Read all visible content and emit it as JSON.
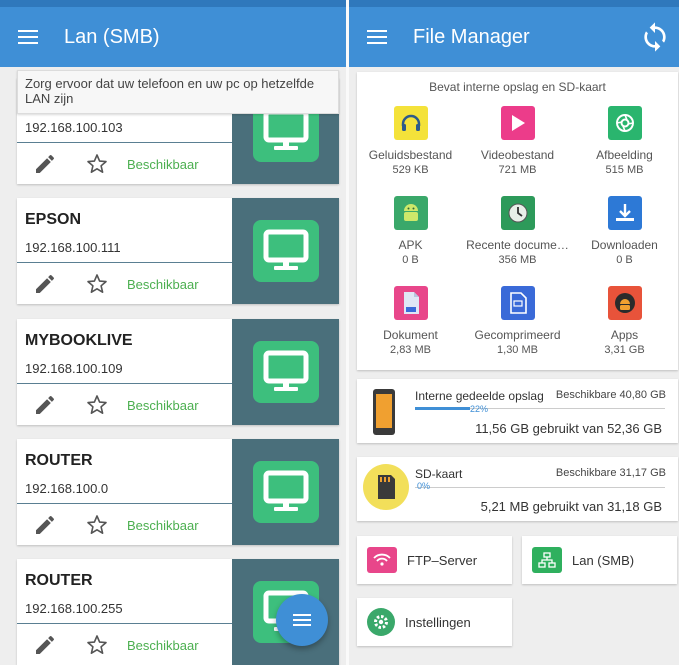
{
  "left": {
    "title": "Lan (SMB)",
    "hint": "Zorg ervoor dat uw telefoon en uw pc op hetzelfde LAN zijn",
    "devices": [
      {
        "name": "",
        "ip": "192.168.100.103",
        "status": "Beschikbaar"
      },
      {
        "name": "EPSON",
        "ip": "192.168.100.111",
        "status": "Beschikbaar"
      },
      {
        "name": "MYBOOKLIVE",
        "ip": "192.168.100.109",
        "status": "Beschikbaar"
      },
      {
        "name": "ROUTER",
        "ip": "192.168.100.0",
        "status": "Beschikbaar"
      },
      {
        "name": "ROUTER",
        "ip": "192.168.100.255",
        "status": "Beschikbaar"
      }
    ]
  },
  "right": {
    "title": "File Manager",
    "categories_header": "Bevat interne opslag en SD-kaart",
    "categories": [
      {
        "label": "Geluidsbestand",
        "size": "529 KB",
        "icon": "headphones-icon",
        "color": "#f4e23a"
      },
      {
        "label": "Videobestand",
        "size": "721 MB",
        "icon": "play-icon",
        "color": "#ec3c8a"
      },
      {
        "label": "Afbeelding",
        "size": "515 MB",
        "icon": "camera-aperture-icon",
        "color": "#2ab56e"
      },
      {
        "label": "APK",
        "size": "0 B",
        "icon": "android-icon",
        "color": "#3aa86a"
      },
      {
        "label": "Recente docume…",
        "size": "356 MB",
        "icon": "clock-icon",
        "color": "#2d9a5a"
      },
      {
        "label": "Downloaden",
        "size": "0 B",
        "icon": "download-icon",
        "color": "#2d79d6"
      },
      {
        "label": "Dokument",
        "size": "2,83 MB",
        "icon": "document-icon",
        "color": "#e8468a"
      },
      {
        "label": "Gecomprimeerd",
        "size": "1,30 MB",
        "icon": "zip-icon",
        "color": "#3a6ad8"
      },
      {
        "label": "Apps",
        "size": "3,31 GB",
        "icon": "apps-icon",
        "color": "#e8533a"
      }
    ],
    "storage": [
      {
        "name": "Interne gedeelde opslag",
        "free": "Beschikbare 40,80 GB",
        "percent_label": "22%",
        "percent": 22,
        "used": "11,56 GB gebruikt van 52,36 GB",
        "icon": "phone-icon"
      },
      {
        "name": "SD-kaart",
        "free": "Beschikbare 31,17 GB",
        "percent_label": "0%",
        "percent": 0,
        "used": "5,21 MB gebruikt van 31,18 GB",
        "icon": "sd-card-icon"
      }
    ],
    "tiles": {
      "ftp": "FTP–Server",
      "lan": "Lan (SMB)",
      "settings": "Instellingen"
    },
    "colors": {
      "accent": "#3f8fd6",
      "ftp": "#e8468a",
      "lan": "#2fb05e",
      "settings": "#3aa86a"
    }
  }
}
